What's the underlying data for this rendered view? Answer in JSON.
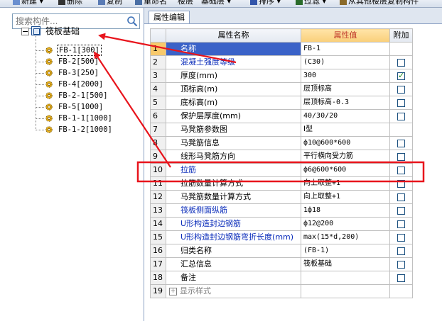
{
  "toolbar": {
    "items": [
      "新建",
      "删除",
      "复制",
      "重命名",
      "楼层",
      "基础层",
      "排序",
      "过滤",
      "从其他楼层复制构件"
    ]
  },
  "left": {
    "search_placeholder": "搜索构件...",
    "tree_root": "筏板基础",
    "tree_items": [
      "FB-1[300]",
      "FB-2[500]",
      "FB-3[250]",
      "FB-4[2000]",
      "FB-2-1[500]",
      "FB-5[1000]",
      "FB-1-1[1000]",
      "FB-1-2[1000]"
    ],
    "selected_item": "FB-1[300]"
  },
  "tab": {
    "label": "属性编辑"
  },
  "grid": {
    "headers": {
      "name": "属性名称",
      "value": "属性值",
      "extra": "附加"
    },
    "rows": [
      {
        "num": "1",
        "name": "名称",
        "value": "FB-1",
        "check": "none",
        "blue": true,
        "selected": true
      },
      {
        "num": "2",
        "name": "混凝土强度等级",
        "value": "(C30)",
        "check": "off",
        "blue": true
      },
      {
        "num": "3",
        "name": "厚度(mm)",
        "value": "300",
        "check": "on",
        "blue": false
      },
      {
        "num": "4",
        "name": "顶标高(m)",
        "value": "层顶标高",
        "check": "off",
        "blue": false
      },
      {
        "num": "5",
        "name": "底标高(m)",
        "value": "层顶标高-0.3",
        "check": "off",
        "blue": false
      },
      {
        "num": "6",
        "name": "保护层厚度(mm)",
        "value": "40/30/20",
        "check": "off",
        "blue": false
      },
      {
        "num": "7",
        "name": "马凳筋参数图",
        "value": "Ⅰ型",
        "check": "none",
        "blue": false
      },
      {
        "num": "8",
        "name": "马凳筋信息",
        "value": "ф10@600*600",
        "check": "off",
        "blue": false
      },
      {
        "num": "9",
        "name": "线形马凳筋方向",
        "value": "平行横向受力筋",
        "check": "off",
        "blue": false
      },
      {
        "num": "10",
        "name": "拉筋",
        "value": "ф6@600*600",
        "check": "off",
        "blue": true
      },
      {
        "num": "11",
        "name": "拉筋数量计算方式",
        "value": "向上取整+1",
        "check": "off",
        "blue": false
      },
      {
        "num": "12",
        "name": "马凳筋数量计算方式",
        "value": "向上取整+1",
        "check": "off",
        "blue": false
      },
      {
        "num": "13",
        "name": "筏板侧面纵筋",
        "value": "1ф18",
        "check": "off",
        "blue": true
      },
      {
        "num": "14",
        "name": "U形构造封边钢筋",
        "value": "ф12@200",
        "check": "off",
        "blue": true
      },
      {
        "num": "15",
        "name": "U形构造封边钢筋弯折长度(mm)",
        "value": "max(15*d,200)",
        "check": "off",
        "blue": true
      },
      {
        "num": "16",
        "name": "归类名称",
        "value": "(FB-1)",
        "check": "off",
        "blue": false
      },
      {
        "num": "17",
        "name": "汇总信息",
        "value": "筏板基础",
        "check": "off",
        "blue": false
      },
      {
        "num": "18",
        "name": "备注",
        "value": "",
        "check": "off",
        "blue": false
      },
      {
        "num": "19",
        "name": "显示样式",
        "value": "",
        "check": "none",
        "blue": false,
        "group": true
      }
    ]
  },
  "colors": {
    "annotation": "#e8141c",
    "selected_row": "#3a62c8",
    "value_header": "#f9cf7a"
  }
}
